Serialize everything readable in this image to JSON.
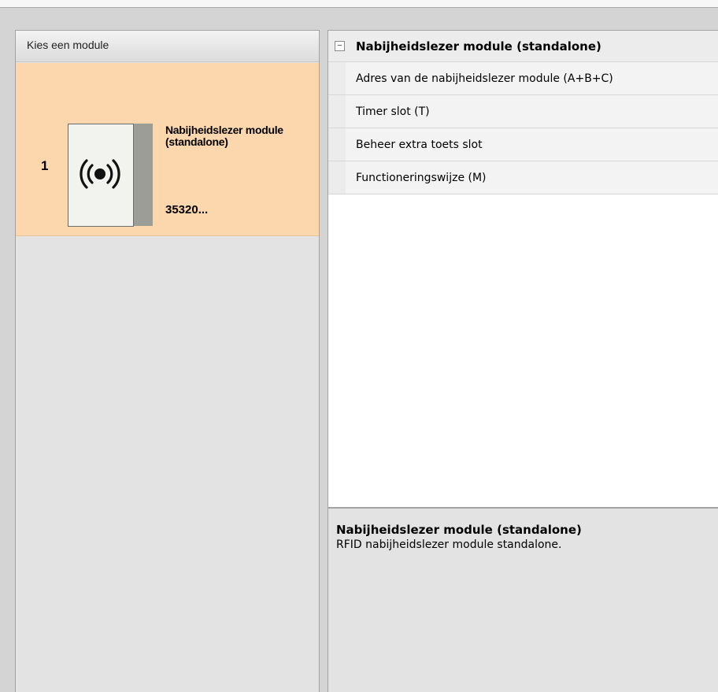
{
  "left_panel": {
    "title": "Kies een module",
    "modules": [
      {
        "index": "1",
        "name": "Nabijheidslezer module (standalone)",
        "code": "35320...",
        "icon": "rfid-signal-icon"
      }
    ]
  },
  "property_grid": {
    "category": "Nabijheidslezer module (standalone)",
    "collapse_glyph": "⊟",
    "properties": [
      {
        "label": "Adres van de nabijheidslezer module (A+B+C)"
      },
      {
        "label": "Timer slot (T)"
      },
      {
        "label": "Beheer extra toets slot"
      },
      {
        "label": "Functioneringswijze (M)"
      }
    ]
  },
  "description": {
    "title": "Nabijheidslezer module (standalone)",
    "text": "RFID nabijheidslezer module standalone."
  },
  "colors": {
    "selected_module": "#fcd7ad",
    "panel_background": "#e3e3e3",
    "grid_background": "#ffffff"
  }
}
